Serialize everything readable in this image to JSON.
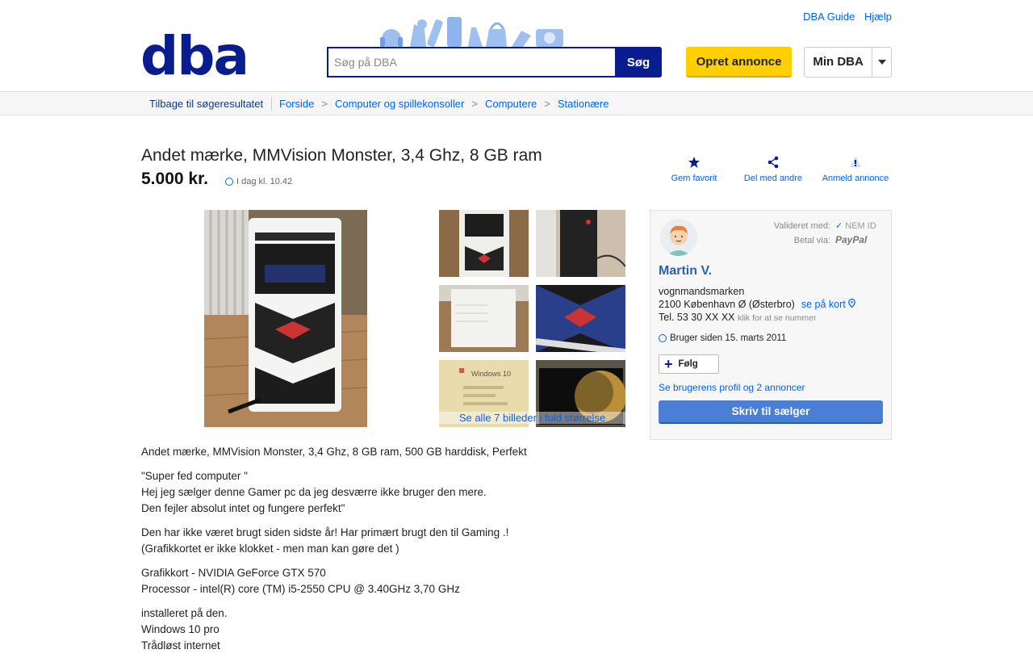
{
  "header": {
    "logo": "dba",
    "links": [
      "DBA Guide",
      "Hjælp"
    ],
    "search_placeholder": "Søg på DBA",
    "search_button": "Søg",
    "create_button": "Opret annonce",
    "my_dba": "Min DBA"
  },
  "breadcrumb": {
    "back": "Tilbage til søgeresultatet",
    "items": [
      "Forside",
      "Computer og spillekonsoller",
      "Computere",
      "Stationære"
    ]
  },
  "listing": {
    "title": "Andet mærke, MMVision Monster, 3,4 Ghz, 8 GB ram",
    "price": "5.000 kr.",
    "time": "I dag kl. 10.42",
    "actions": [
      "Gem favorit",
      "Del med andre",
      "Anmeld annonce"
    ],
    "see_all": "Se alle 7 billeder i fuld størrelse",
    "thumb_label_windows": "Windows 10"
  },
  "seller": {
    "validated_label": "Valideret med:",
    "validated_value": "NEM ID",
    "pay_label": "Betal via:",
    "pay_value": "PayPal",
    "name": "Martin V.",
    "street": "vognmandsmarken",
    "city": "2100 København Ø (Østerbro)",
    "map_link": "se på kort",
    "phone": "Tel. 53 30 XX XX",
    "phone_hint": "klik for at se nummer",
    "since": "Bruger siden 15. marts 2011",
    "follow": "Følg",
    "profile_link": "Se brugerens profil og 2 annoncer",
    "write_button": "Skriv til sælger"
  },
  "description": {
    "p1": [
      "Andet mærke, MMVision Monster, 3,4 Ghz, 8 GB ram, 500 GB harddisk, Perfekt"
    ],
    "p2": [
      "\"Super fed computer \"",
      "Hej jeg sælger denne Gamer pc da jeg desværre ikke bruger den mere.",
      "Den fejler absolut intet og fungere perfekt\""
    ],
    "p3": [
      "Den har ikke været brugt siden sidste år! Har primært brugt den til Gaming .!",
      "(Grafikkortet er ikke klokket - men man kan gøre det )"
    ],
    "p4": [
      "Grafikkort - NVIDIA GeForce GTX 570",
      "Processor - intel(R) core (TM) i5-2550 CPU @ 3.40GHz 3,70 GHz"
    ],
    "p5": [
      "installeret på den.",
      "Windows 10 pro",
      "Trådløst internet"
    ]
  },
  "colors": {
    "brand": "#0a1d8f",
    "link": "#0063fb",
    "yellow": "#ffcf00",
    "button_blue": "#4a7fd5"
  }
}
